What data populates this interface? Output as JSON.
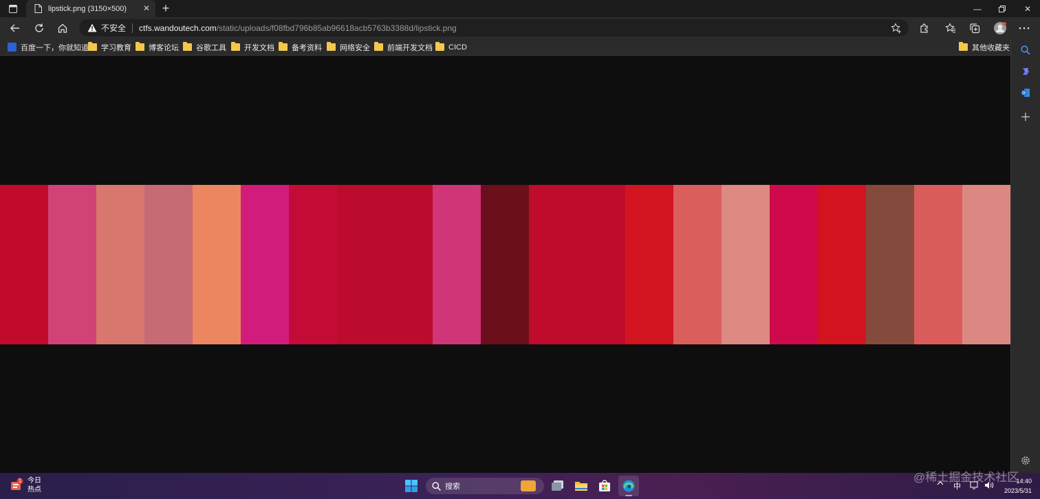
{
  "browser": {
    "tab": {
      "title": "lipstick.png (3150×500)"
    },
    "address": {
      "security_label": "不安全",
      "url_host": "ctfs.wandoutech.com",
      "url_path": "/static/uploads/f08fbd796b85ab96618acb5763b3388d/lipstick.png"
    },
    "bookmarks": [
      {
        "label": "百度一下，你就知道",
        "icon": "baidu-icon"
      },
      {
        "label": "学习教育",
        "icon": "folder-icon"
      },
      {
        "label": "博客论坛",
        "icon": "folder-icon"
      },
      {
        "label": "谷歌工具",
        "icon": "folder-icon"
      },
      {
        "label": "开发文档",
        "icon": "folder-icon"
      },
      {
        "label": "备考资料",
        "icon": "folder-icon"
      },
      {
        "label": "网络安全",
        "icon": "folder-icon"
      },
      {
        "label": "前端开发文档",
        "icon": "folder-icon"
      },
      {
        "label": "CICD",
        "icon": "folder-icon"
      }
    ],
    "other_bookmarks": "其他收藏夹"
  },
  "image": {
    "swatches": [
      "#c20a2c",
      "#d14277",
      "#d8776d",
      "#c66b74",
      "#ec8661",
      "#d21c7c",
      "#c40b38",
      "#bc0b2c",
      "#bc0b2c",
      "#d03577",
      "#6b0f1c",
      "#bf0b2c",
      "#bf0b2c",
      "#d21320",
      "#da5f5c",
      "#dc8a82",
      "#ce0a4c",
      "#d3131f",
      "#844a3c",
      "#da5d5c",
      "#dc8882"
    ]
  },
  "taskbar": {
    "weather": {
      "title": "今日",
      "subtitle": "热点",
      "badge": "1"
    },
    "search_label": "搜索",
    "ime": "中",
    "time": "14:40",
    "date": "2023/5/31"
  },
  "watermark": "@稀土掘金技术社区"
}
